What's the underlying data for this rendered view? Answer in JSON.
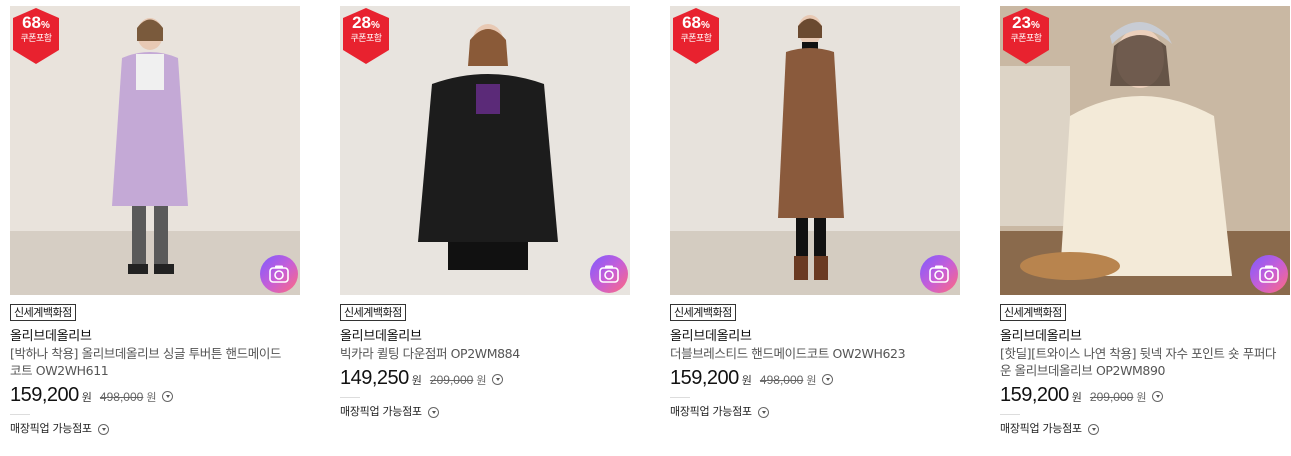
{
  "products": [
    {
      "discount": "68",
      "percent_sign": "%",
      "coupon_label": "쿠폰포함",
      "store": "신세계백화점",
      "brand": "올리브데올리브",
      "name": "[박하나 착용] 올리브데올리브 싱글 투버튼 핸드메이드 코트 OW2WH611",
      "price": "159,200",
      "currency": "원",
      "original_price": "498,000",
      "pickup": "매장픽업 가능점포",
      "colors": {
        "wall": "#e9e3dc",
        "floor": "#d6cec4",
        "garment": "#c4a9d6"
      }
    },
    {
      "discount": "28",
      "percent_sign": "%",
      "coupon_label": "쿠폰포함",
      "store": "신세계백화점",
      "brand": "올리브데올리브",
      "name": "빅카라 퀼팅 다운점퍼 OP2WM884",
      "price": "149,250",
      "currency": "원",
      "original_price": "209,000",
      "pickup": "매장픽업 가능점포",
      "colors": {
        "wall": "#e8e4df",
        "floor": "#e8e4df",
        "garment": "#1c1c1c"
      }
    },
    {
      "discount": "68",
      "percent_sign": "%",
      "coupon_label": "쿠폰포함",
      "store": "신세계백화점",
      "brand": "올리브데올리브",
      "name": "더블브레스티드 핸드메이드코트 OW2WH623",
      "price": "159,200",
      "currency": "원",
      "original_price": "498,000",
      "pickup": "매장픽업 가능점포",
      "colors": {
        "wall": "#e7e2dc",
        "floor": "#d4ccc1",
        "garment": "#8a5a3c"
      }
    },
    {
      "discount": "23",
      "percent_sign": "%",
      "coupon_label": "쿠폰포함",
      "store": "신세계백화점",
      "brand": "올리브데올리브",
      "name": "[핫딜][트와이스 나연 착용] 뒷넥 자수 포인트 숏 푸퍼다운 올리브데올리브 OP2WM890",
      "price": "159,200",
      "currency": "원",
      "original_price": "209,000",
      "pickup": "매장픽업 가능점포",
      "colors": {
        "wall": "#c9b8a3",
        "floor": "#8a6a4c",
        "garment": "#f3ead8"
      }
    }
  ],
  "theme": {
    "badge_color": "#e8222f",
    "accent": "#111111"
  }
}
